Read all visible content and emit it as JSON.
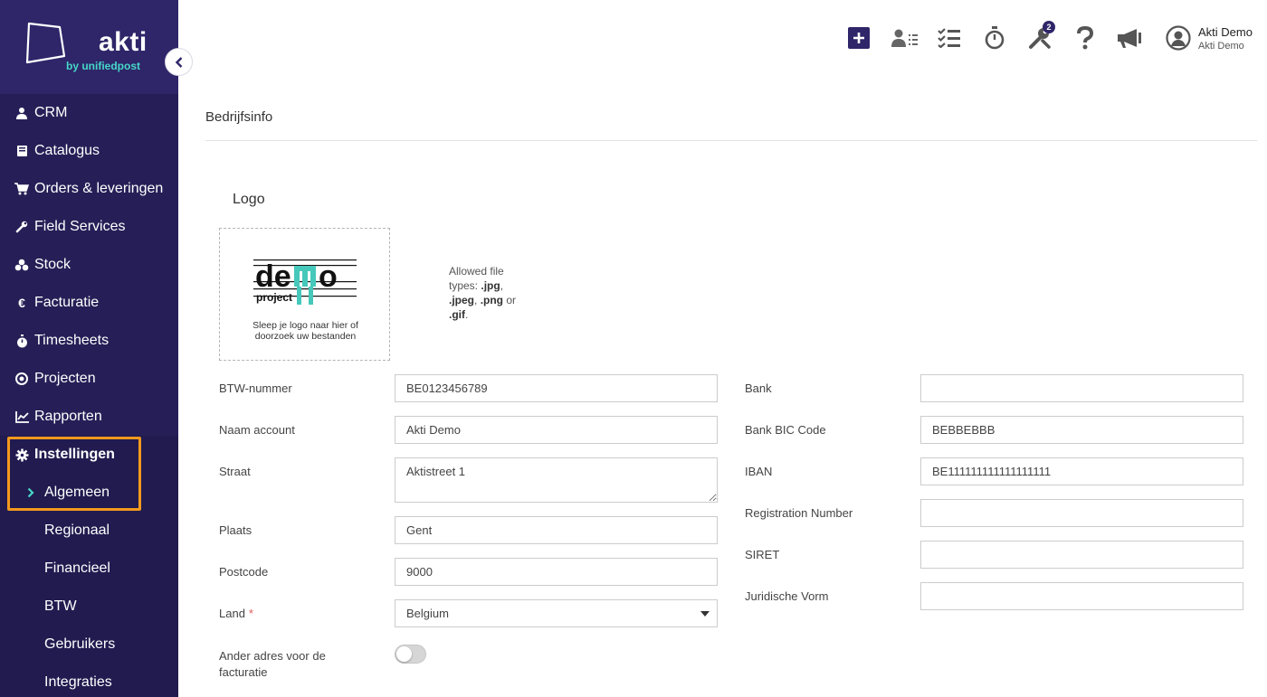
{
  "brand": {
    "name": "akti",
    "tagline": "by unifiedpost"
  },
  "colors": {
    "sidebar": "#261f57",
    "brand_bg": "#2e2669",
    "accent_teal": "#46d7c8",
    "highlight": "#f39a1d",
    "primary_button": "#2e2669"
  },
  "sidebar": {
    "items": [
      {
        "label": "CRM",
        "icon": "person-icon"
      },
      {
        "label": "Catalogus",
        "icon": "book-icon"
      },
      {
        "label": "Orders & leveringen",
        "icon": "cart-icon"
      },
      {
        "label": "Field Services",
        "icon": "wrench-icon"
      },
      {
        "label": "Stock",
        "icon": "boxes-icon"
      },
      {
        "label": "Facturatie",
        "icon": "euro-icon"
      },
      {
        "label": "Timesheets",
        "icon": "stopwatch-icon"
      },
      {
        "label": "Projecten",
        "icon": "target-icon"
      },
      {
        "label": "Rapporten",
        "icon": "chart-line-icon"
      }
    ],
    "settings": {
      "label": "Instellingen",
      "icon": "gear-icon"
    },
    "settings_active": {
      "label": "Algemeen",
      "icon": "chevron-right-icon"
    },
    "settings_sub": [
      "Regionaal",
      "Financieel",
      "BTW",
      "Gebruikers",
      "Integraties"
    ]
  },
  "topbar": {
    "icons": [
      "plus-icon",
      "contacts-list-icon",
      "checklist-icon",
      "stopwatch-icon",
      "tools-icon",
      "help-icon",
      "megaphone-icon"
    ],
    "tools_badge": "2",
    "user": {
      "name": "Akti Demo",
      "account": "Akti Demo"
    }
  },
  "page": {
    "title": "Bedrijfsinfo"
  },
  "logo_section": {
    "heading": "Logo",
    "dropzone_line1": "Sleep je logo naar hier of",
    "dropzone_line2": "doorzoek uw bestanden",
    "logo_text_top": "demo",
    "logo_text_bottom": "project",
    "allowed_prefix": "Allowed file types:",
    "allowed_jpg": ".jpg",
    "allowed_jpeg": ".jpeg",
    "allowed_png": ".png",
    "allowed_or": "or",
    "allowed_gif": ".gif"
  },
  "form_left": {
    "btw": {
      "label": "BTW-nummer",
      "value": "BE0123456789"
    },
    "naam": {
      "label": "Naam account",
      "value": "Akti Demo"
    },
    "straat": {
      "label": "Straat",
      "value": "Aktistreet 1"
    },
    "plaats": {
      "label": "Plaats",
      "value": "Gent"
    },
    "postcode": {
      "label": "Postcode",
      "value": "9000"
    },
    "land": {
      "label": "Land",
      "required": "*",
      "value": "Belgium"
    },
    "ander_adres": {
      "label_line1": "Ander adres voor de",
      "label_line2": "facturatie",
      "enabled": false
    }
  },
  "form_right": {
    "bank": {
      "label": "Bank",
      "value": ""
    },
    "bic": {
      "label": "Bank BIC Code",
      "value": "BEBBEBBB"
    },
    "iban": {
      "label": "IBAN",
      "value": "BE111111111111111111"
    },
    "regnr": {
      "label": "Registration Number",
      "value": ""
    },
    "siret": {
      "label": "SIRET",
      "value": ""
    },
    "juridisch": {
      "label": "Juridische Vorm",
      "value": ""
    }
  }
}
